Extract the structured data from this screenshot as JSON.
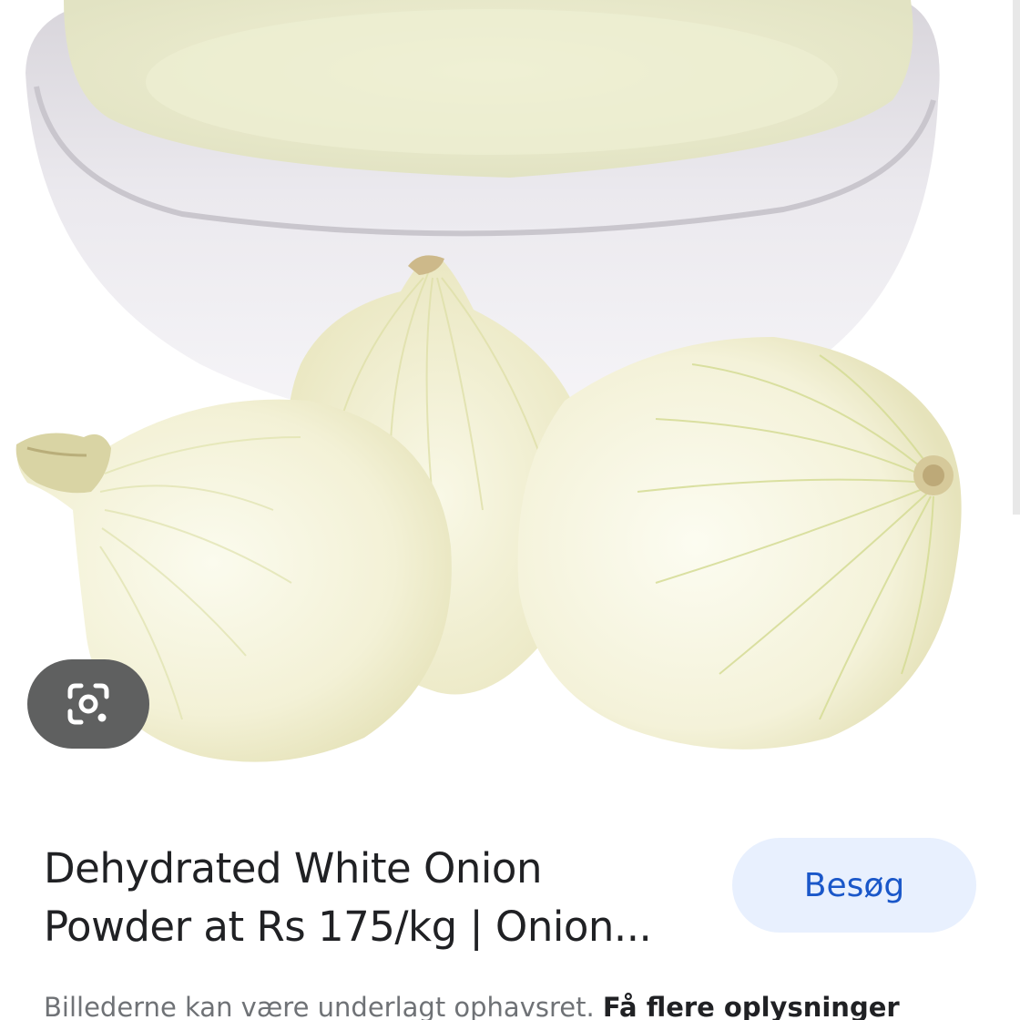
{
  "result": {
    "title_line1": "Dehydrated White Onion",
    "title_line2": "Powder at Rs 175/kg | Onion...",
    "visit_label": "Besøg"
  },
  "footer": {
    "copyright_text": "Billederne kan være underlagt ophavsret.",
    "more_info_link": "Få flere oplysninger"
  },
  "icons": {
    "lens": "google-lens-icon"
  },
  "colors": {
    "visit_button_bg": "#e8f0fe",
    "visit_button_text": "#1a57c9",
    "lens_button_bg": "#5f6060",
    "title_text": "#202124",
    "secondary_text": "#6f7276"
  }
}
